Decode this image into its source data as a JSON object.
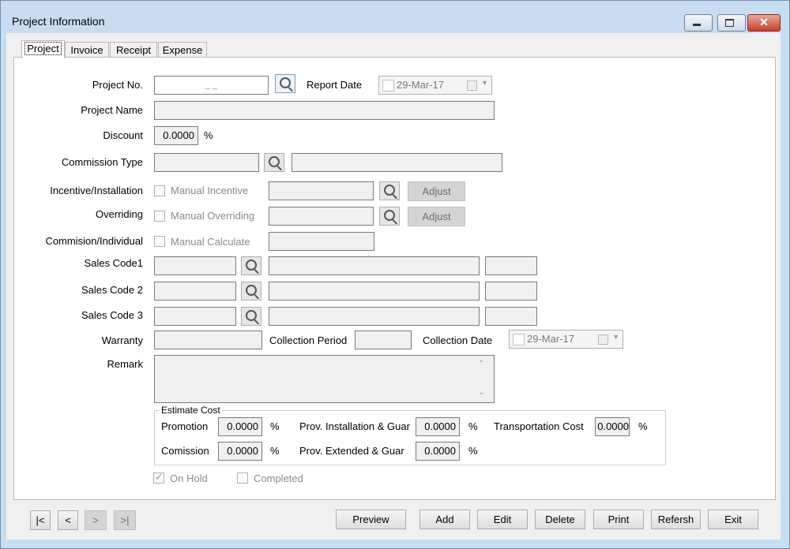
{
  "window": {
    "title": "Project Information"
  },
  "tabs": [
    "Project",
    "Invoice",
    "Receipt",
    "Expense"
  ],
  "form": {
    "project_no_label": "Project No.",
    "project_no_value": "_ _",
    "report_date_label": "Report Date",
    "report_date_value": "29-Mar-17",
    "project_name_label": "Project Name",
    "discount_label": "Discount",
    "discount_value": "0.0000",
    "percent": "%",
    "commission_type_label": "Commission Type",
    "incentive_label": "Incentive/Installation",
    "manual_incentive_label": "Manual Incentive",
    "adjust_label": "Adjust",
    "overriding_label": "Overriding",
    "manual_overriding_label": "Manual Overriding",
    "commission_individual_label": "Commision/Individual",
    "manual_calculate_label": "Manual Calculate",
    "sales_code1_label": "Sales Code1",
    "sales_code2_label": "Sales Code 2",
    "sales_code3_label": "Sales Code 3",
    "warranty_label": "Warranty",
    "collection_period_label": "Collection Period",
    "collection_date_label": "Collection Date",
    "collection_date_value": "29-Mar-17",
    "remark_label": "Remark"
  },
  "estimate": {
    "title": "Estimate Cost",
    "promotion_label": "Promotion",
    "promotion_value": "0.0000",
    "prov_install_label": "Prov. Installation & Guar",
    "prov_install_value": "0.0000",
    "transport_label": "Transportation Cost",
    "transport_value": "0.0000",
    "commission_label": "Comission",
    "commission_value": "0.0000",
    "prov_ext_label": "Prov. Extended & Guar",
    "prov_ext_value": "0.0000"
  },
  "status": {
    "on_hold_label": "On Hold",
    "on_hold_checked": true,
    "completed_label": "Completed",
    "completed_checked": false
  },
  "nav": {
    "first": "|<",
    "prev": "<",
    "next": ">",
    "last": ">|"
  },
  "actions": {
    "preview": "Preview",
    "add": "Add",
    "edit": "Edit",
    "delete": "Delete",
    "print": "Print",
    "refresh": "Refersh",
    "exit": "Exit"
  }
}
